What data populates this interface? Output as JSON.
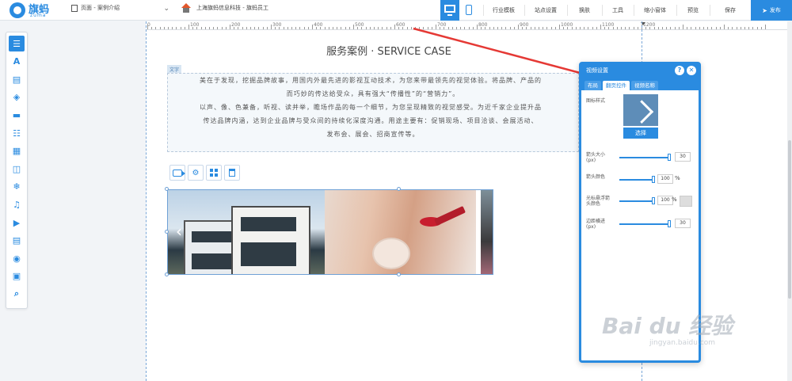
{
  "logo": {
    "name": "旗蚂",
    "sub": "zuma"
  },
  "topbar": {
    "page_label": "页面 - 案例介绍",
    "site_label": "上海旗蚂信息科技 - 旗蚂员工",
    "menu": [
      "行业模板",
      "站点设置",
      "换肤",
      "工具",
      "缩小窗体",
      "预览",
      "保存"
    ],
    "publish": "发布"
  },
  "ruler": {
    "labels": [
      "100",
      "200",
      "300",
      "400",
      "500",
      "600",
      "700",
      "800",
      "900",
      "1000",
      "1100",
      "1200"
    ],
    "zero": "0"
  },
  "section": {
    "title": "服务案例 · SERVICE CASE",
    "text_tag": "文字",
    "paragraphs": [
      "美在于发现，挖掘品牌故事，用国内外最先进的影视互动技术，为您来带最领先的视觉体验。将品牌、产品的",
      "而巧妙的传达给受众，具有强大“传播性”的“营销力”。",
      "以声、像、色兼备，听视、读并举，瞻场作品的每一个细节，为您呈现精致的视觉感受。为近千家企业提升品",
      "传达品牌内涵，达到企业品牌与受众间的持续化深度沟通。用途主要有：促销现场、项目洽谈、会展活动、",
      "发布会、展会、招商宣传等。"
    ]
  },
  "dialog": {
    "title": "视频设置",
    "tabs": [
      "布局",
      "翻页控件",
      "视频名称"
    ],
    "icon_style_label": "图标样式",
    "select_label": "选择",
    "rows": [
      {
        "label": "箭头大小(px)",
        "value": "30",
        "fill": 0.95
      },
      {
        "label": "箭头颜色",
        "value": "100",
        "unit": "%",
        "fill": 0.95
      },
      {
        "label": "光标悬浮箭头颜色",
        "value": "100",
        "unit": "%",
        "fill": 0.95
      },
      {
        "label": "边距横进(px)",
        "value": "30",
        "fill": 0.95
      }
    ]
  },
  "tools": [
    "list-icon",
    "text-icon",
    "image-text-icon",
    "shapes-icon",
    "line-icon",
    "list-items-icon",
    "gallery-icon",
    "shop-icon",
    "snowflake-icon",
    "music-icon",
    "video-icon",
    "document-icon",
    "play-icon",
    "picture-icon",
    "search-icon"
  ],
  "watermark": {
    "main": "Bai du 经验",
    "sub": "jingyan.baidu.com"
  },
  "colors": {
    "accent": "#2a8be0",
    "arrow": "#e53935"
  }
}
